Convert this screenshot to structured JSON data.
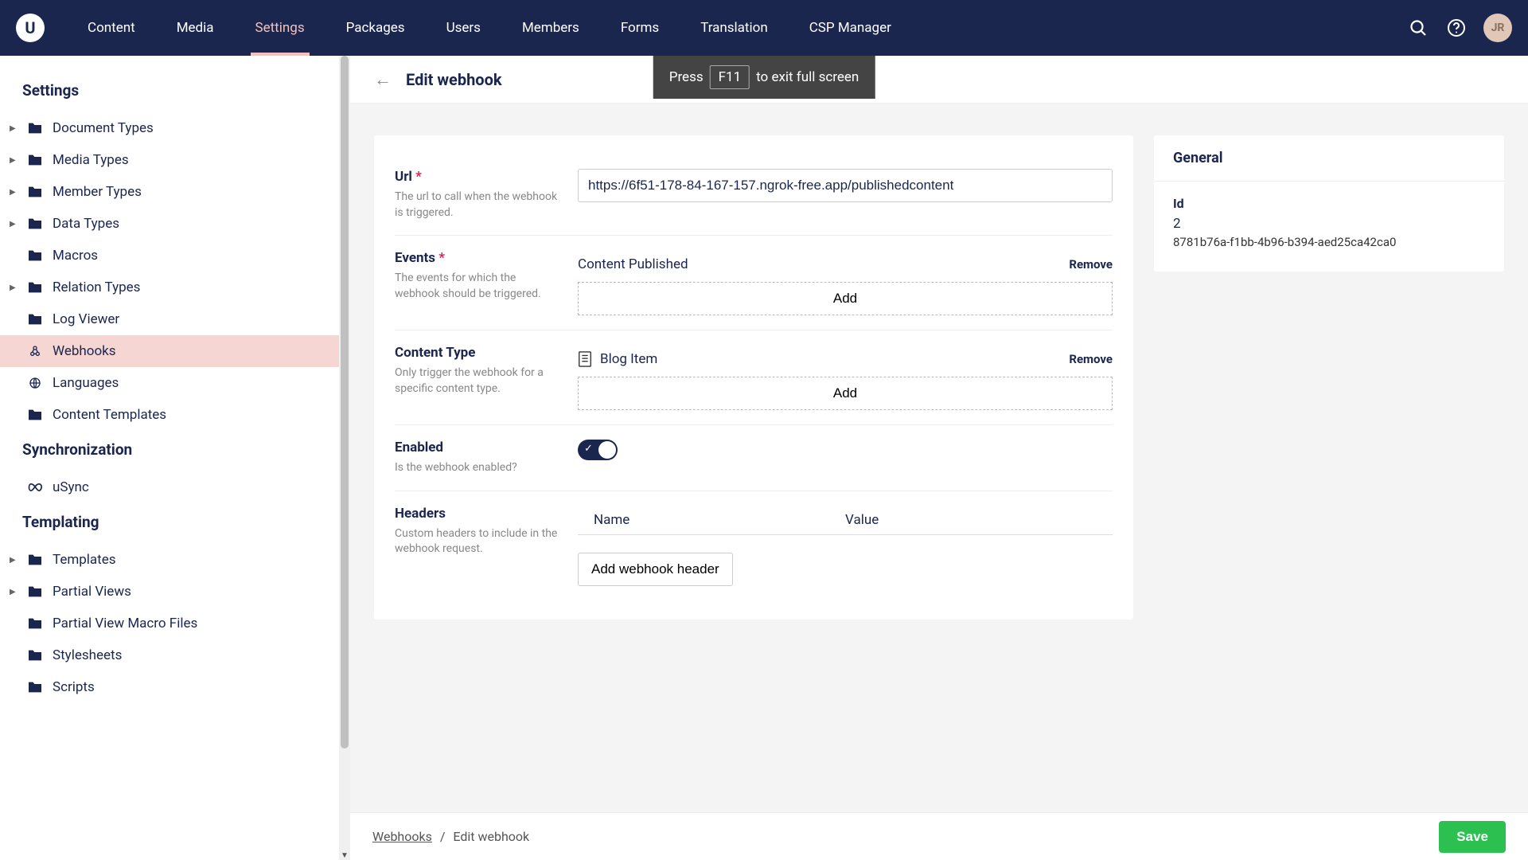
{
  "nav": {
    "items": [
      "Content",
      "Media",
      "Settings",
      "Packages",
      "Users",
      "Members",
      "Forms",
      "Translation",
      "CSP Manager"
    ],
    "active": "Settings",
    "avatar": "JR"
  },
  "fullscreen": {
    "pre": "Press",
    "key": "F11",
    "post": "to exit full screen"
  },
  "sidebar": {
    "sections": [
      {
        "title": "Settings",
        "items": [
          {
            "label": "Document Types",
            "expandable": true,
            "icon": "folder"
          },
          {
            "label": "Media Types",
            "expandable": true,
            "icon": "folder"
          },
          {
            "label": "Member Types",
            "expandable": true,
            "icon": "folder"
          },
          {
            "label": "Data Types",
            "expandable": true,
            "icon": "folder"
          },
          {
            "label": "Macros",
            "expandable": false,
            "icon": "folder"
          },
          {
            "label": "Relation Types",
            "expandable": true,
            "icon": "folder"
          },
          {
            "label": "Log Viewer",
            "expandable": false,
            "icon": "folder"
          },
          {
            "label": "Webhooks",
            "expandable": false,
            "icon": "webhook",
            "active": true
          },
          {
            "label": "Languages",
            "expandable": false,
            "icon": "globe"
          },
          {
            "label": "Content Templates",
            "expandable": false,
            "icon": "folder"
          }
        ]
      },
      {
        "title": "Synchronization",
        "items": [
          {
            "label": "uSync",
            "expandable": false,
            "icon": "infinity"
          }
        ]
      },
      {
        "title": "Templating",
        "items": [
          {
            "label": "Templates",
            "expandable": true,
            "icon": "folder"
          },
          {
            "label": "Partial Views",
            "expandable": true,
            "icon": "folder"
          },
          {
            "label": "Partial View Macro Files",
            "expandable": false,
            "icon": "folder"
          },
          {
            "label": "Stylesheets",
            "expandable": false,
            "icon": "folder"
          },
          {
            "label": "Scripts",
            "expandable": false,
            "icon": "folder"
          }
        ]
      }
    ]
  },
  "page": {
    "title": "Edit webhook",
    "form": {
      "url": {
        "label": "Url",
        "desc": "The url to call when the webhook is triggered.",
        "value": "https://6f51-178-84-167-157.ngrok-free.app/publishedcontent"
      },
      "events": {
        "label": "Events",
        "desc": "The events for which the webhook should be triggered.",
        "items": [
          "Content Published"
        ],
        "remove": "Remove",
        "add": "Add"
      },
      "contentType": {
        "label": "Content Type",
        "desc": "Only trigger the webhook for a specific content type.",
        "items": [
          "Blog Item"
        ],
        "remove": "Remove",
        "add": "Add"
      },
      "enabled": {
        "label": "Enabled",
        "desc": "Is the webhook enabled?",
        "value": true
      },
      "headers": {
        "label": "Headers",
        "desc": "Custom headers to include in the webhook request.",
        "cols": [
          "Name",
          "Value"
        ],
        "addLabel": "Add webhook header"
      }
    },
    "general": {
      "title": "General",
      "idLabel": "Id",
      "id": "2",
      "guid": "8781b76a-f1bb-4b96-b394-aed25ca42ca0"
    },
    "breadcrumb": {
      "parent": "Webhooks",
      "current": "Edit webhook"
    },
    "save": "Save"
  }
}
